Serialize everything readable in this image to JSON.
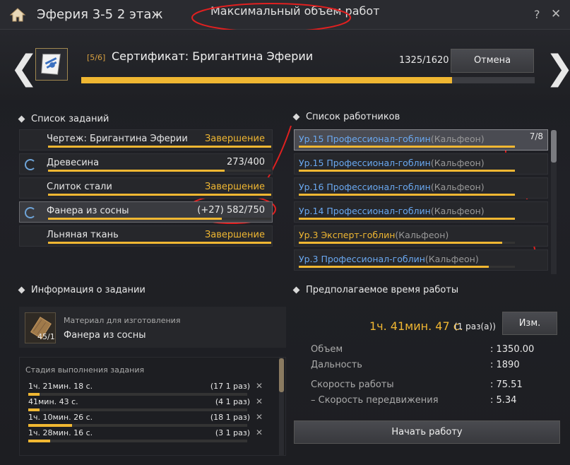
{
  "window": {
    "title": "Эферия 3-5 2 этаж",
    "subtitle": "Максимальный объем работ",
    "help_label": "?",
    "close_label": "✕"
  },
  "certificate": {
    "count": "[5/6]",
    "name": "Сертификат: Бригантина Эферии",
    "progress_text": "1325/1620",
    "progress_fraction": 0.818,
    "cancel_label": "Отмена"
  },
  "task_list": {
    "header": "Список заданий",
    "items": [
      {
        "name": "Чертеж: Бригантина Эферии",
        "status": "Завершение",
        "bar": 1.0,
        "spin": false
      },
      {
        "name": "Древесина",
        "status": "273/400",
        "bar": 0.79,
        "spin": true
      },
      {
        "name": "Слиток стали",
        "status": "Завершение",
        "bar": 1.0,
        "spin": false
      },
      {
        "name": "Фанера из сосны",
        "status": "(+27)  582/750",
        "bar": 0.78,
        "spin": true
      },
      {
        "name": "Льняная ткань",
        "status": "Завершение",
        "bar": 1.0,
        "spin": false
      }
    ]
  },
  "worker_list": {
    "header": "Список работников",
    "count": "7/8",
    "items": [
      {
        "name": "Ур.15 Профессионал-гоблин",
        "town": "(Кальфеон)",
        "color": "blue",
        "bar": 1.0
      },
      {
        "name": "Ур.15 Профессионал-гоблин",
        "town": "(Кальфеон)",
        "color": "blue",
        "bar": 1.0
      },
      {
        "name": "Ур.16 Профессионал-гоблин",
        "town": "(Кальфеон)",
        "color": "blue",
        "bar": 1.0
      },
      {
        "name": "Ур.14 Профессионал-гоблин",
        "town": "(Кальфеон)",
        "color": "blue",
        "bar": 1.0
      },
      {
        "name": "Ур.3 Эксперт-гоблин",
        "town": "(Кальфеон)",
        "color": "gold",
        "bar": 0.94
      },
      {
        "name": "Ур.3 Профессионал-гоблин",
        "town": "(Кальфеон)",
        "color": "blue",
        "bar": 0.88
      }
    ]
  },
  "task_info": {
    "header": "Информация о задании",
    "material_label": "Материал для изготовления",
    "material_name": "Фанера из сосны",
    "material_qty": "45/1",
    "stage_title": "Стадия выполнения задания",
    "stages": [
      {
        "time": "1ч. 21мин. 18 с.",
        "count": "(17 1 раз)",
        "bar": 0.05
      },
      {
        "time": "41мин. 43 с.",
        "count": "(4 1 раз)",
        "bar": 0.05
      },
      {
        "time": "1ч. 10мин. 26 с.",
        "count": "(18 1 раз)",
        "bar": 0.2
      },
      {
        "time": "1ч. 28мин. 16 с.",
        "count": "(3 1 раз)",
        "bar": 0.1
      }
    ]
  },
  "work_time": {
    "header": "Предполагаемое время работы",
    "value": "1ч. 41мин. 47 с.",
    "runs": "(1 раз(а))",
    "change_label": "Изм.",
    "stats": [
      {
        "label": "Объем",
        "value": ": 1350.00"
      },
      {
        "label": "Дальность",
        "value": ": 1890"
      },
      {
        "label": "Скорость работы",
        "value": ": 75.51"
      },
      {
        "label": "– Скорость передвижения",
        "value": ": 5.34"
      }
    ],
    "start_label": "Начать работу"
  }
}
